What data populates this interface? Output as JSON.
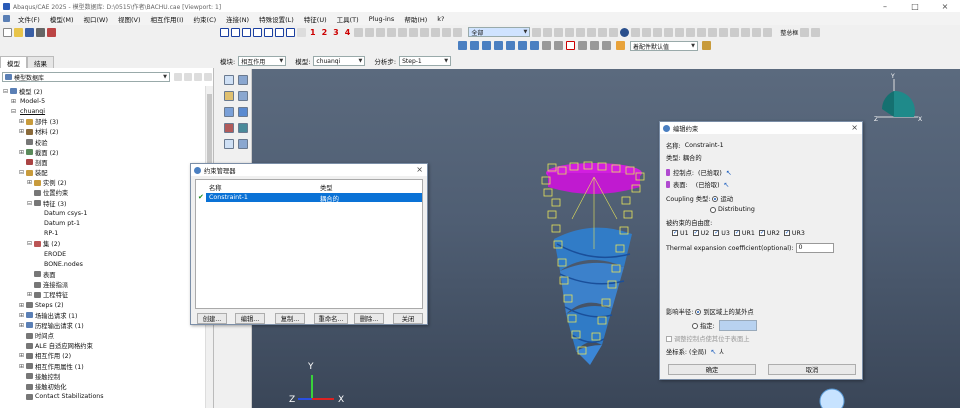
{
  "window": {
    "title": "Abaqus/CAE 2025 - 模型数据库: D:\\0515\\作者\\BACHU.cae [Viewport: 1]"
  },
  "menu": [
    "文件(F)",
    "模型(M)",
    "视口(W)",
    "视图(V)",
    "相互作用(I)",
    "约束(C)",
    "连接(N)",
    "特殊设置(L)",
    "特征(U)",
    "工具(T)",
    "Plug-ins",
    "帮助(H)",
    "k?"
  ],
  "toolbar": {
    "numbers": [
      "1",
      "2",
      "3",
      "4"
    ],
    "display_combo": "全部",
    "render_combo": "着配件默认值",
    "right_label": "整总框"
  },
  "tabs": {
    "model": "模型",
    "results": "结果"
  },
  "context": {
    "module_label": "模块:",
    "module_value": "相互作用",
    "model_label": "模型:",
    "model_value": "chuanqi",
    "step_label": "分析步:",
    "step_value": "Step-1"
  },
  "tree": {
    "combo": "模型数据库",
    "items": [
      {
        "t": "模型 (2)",
        "lvl": 0,
        "tg": "⊟",
        "c": "#5a7fb5"
      },
      {
        "t": "Model-5",
        "lvl": 1,
        "tg": "⊞",
        "c": ""
      },
      {
        "t": "chuanqi",
        "lvl": 1,
        "tg": "⊟",
        "c": "",
        "u": true
      },
      {
        "t": "部件 (3)",
        "lvl": 2,
        "tg": "⊞",
        "c": "#c89b3c"
      },
      {
        "t": "材料 (2)",
        "lvl": 2,
        "tg": "⊞",
        "c": "#8a6a3a"
      },
      {
        "t": "校验",
        "lvl": 2,
        "tg": "",
        "c": "#777"
      },
      {
        "t": "截面 (2)",
        "lvl": 2,
        "tg": "⊞",
        "c": "#5a8a5a"
      },
      {
        "t": "剖面",
        "lvl": 2,
        "tg": "",
        "c": "#a44"
      },
      {
        "t": "装配",
        "lvl": 2,
        "tg": "⊟",
        "c": "#c89b3c"
      },
      {
        "t": "实例 (2)",
        "lvl": 3,
        "tg": "⊞",
        "c": "#c89b3c"
      },
      {
        "t": "位置约束",
        "lvl": 3,
        "tg": "",
        "c": "#777"
      },
      {
        "t": "特征 (3)",
        "lvl": 3,
        "tg": "⊟",
        "c": "#777"
      },
      {
        "t": "Datum csys-1",
        "lvl": 4,
        "tg": "",
        "c": ""
      },
      {
        "t": "Datum pt-1",
        "lvl": 4,
        "tg": "",
        "c": ""
      },
      {
        "t": "RP-1",
        "lvl": 4,
        "tg": "",
        "c": ""
      },
      {
        "t": "集 (2)",
        "lvl": 3,
        "tg": "⊟",
        "c": "#b55"
      },
      {
        "t": "ERODE",
        "lvl": 4,
        "tg": "",
        "c": ""
      },
      {
        "t": "BONE.nodes",
        "lvl": 4,
        "tg": "",
        "c": ""
      },
      {
        "t": "表面",
        "lvl": 3,
        "tg": "",
        "c": "#777"
      },
      {
        "t": "连接指派",
        "lvl": 3,
        "tg": "",
        "c": "#777"
      },
      {
        "t": "工程特征",
        "lvl": 3,
        "tg": "⊞",
        "c": "#777"
      },
      {
        "t": "Steps (2)",
        "lvl": 2,
        "tg": "⊞",
        "c": "#777"
      },
      {
        "t": "场输出请求 (1)",
        "lvl": 2,
        "tg": "⊞",
        "c": "#5a7fb5"
      },
      {
        "t": "历程输出请求 (1)",
        "lvl": 2,
        "tg": "⊞",
        "c": "#5a7fb5"
      },
      {
        "t": "时间点",
        "lvl": 2,
        "tg": "",
        "c": "#777"
      },
      {
        "t": "ALE 自适应网格约束",
        "lvl": 2,
        "tg": "",
        "c": "#777"
      },
      {
        "t": "相互作用 (2)",
        "lvl": 2,
        "tg": "⊞",
        "c": "#777"
      },
      {
        "t": "相互作用属性 (1)",
        "lvl": 2,
        "tg": "⊞",
        "c": "#777"
      },
      {
        "t": "接触控制",
        "lvl": 2,
        "tg": "",
        "c": "#777"
      },
      {
        "t": "接触初始化",
        "lvl": 2,
        "tg": "",
        "c": "#777"
      },
      {
        "t": "Contact Stabilizations",
        "lvl": 2,
        "tg": "",
        "c": "#777"
      }
    ]
  },
  "constraint_manager": {
    "title": "约束管理器",
    "col_name": "名称",
    "col_type": "类型",
    "row_name": "Constraint-1",
    "row_type": "耦合的",
    "buttons": [
      "创建...",
      "编辑...",
      "复制...",
      "重命名...",
      "删除...",
      "关闭"
    ]
  },
  "edit_dialog": {
    "title": "编辑约束",
    "name_label": "名称:",
    "name_value": "Constraint-1",
    "type_label": "类型:",
    "type_value": "耦合的",
    "control_point_label": "控制点:",
    "control_point_value": "(已拾取)",
    "surface_label": "表面:",
    "surface_value": "(已拾取)",
    "coupling_label": "Coupling 类型:",
    "coupling_kinematic": "运动",
    "coupling_distributing": "Distributing",
    "dof_label": "被约束的自由度:",
    "dofs": [
      "U1",
      "U2",
      "U3",
      "UR1",
      "UR2",
      "UR3"
    ],
    "thermal_label": "Thermal expansion coefficient(optional):",
    "thermal_value": "0",
    "influence_label": "影响半径:",
    "influence_opt1": "到区域上的某外点",
    "influence_opt2": "指定:",
    "adjust_label": "调整控制点使其位于表面上",
    "csys_label": "坐标系:",
    "csys_value": "(全局)",
    "ok": "确定",
    "cancel": "取消"
  },
  "triad": {
    "x": "X",
    "y": "Y",
    "z": "Z"
  },
  "colors": {
    "magenta": "#d21fe0",
    "blue": "#2f7fd0",
    "yellow": "#e6e35a",
    "select": "#0a72d6"
  }
}
